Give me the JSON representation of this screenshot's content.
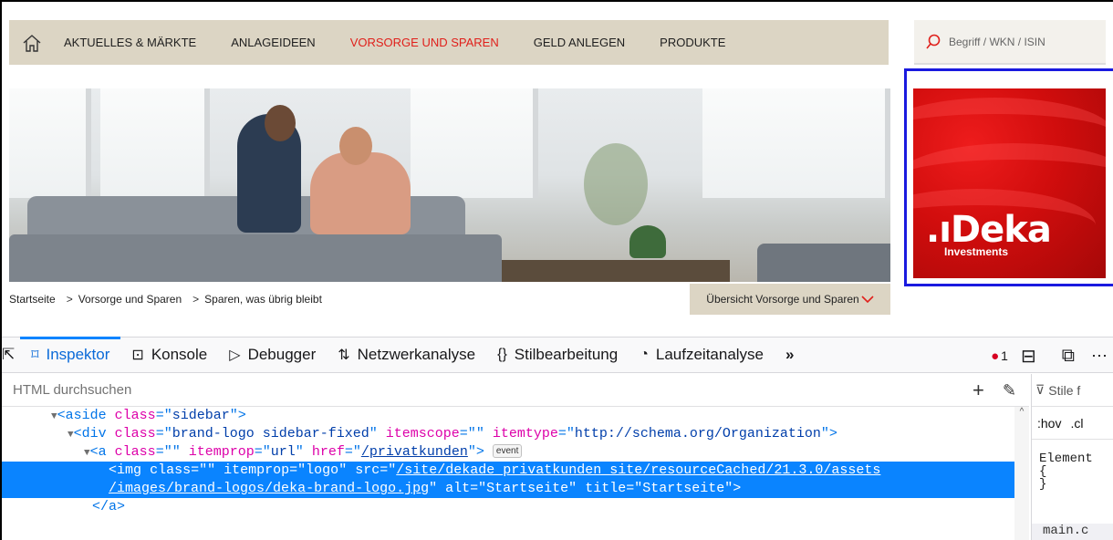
{
  "nav": {
    "items": [
      {
        "label": "AKTUELLES & MÄRKTE",
        "active": false
      },
      {
        "label": "ANLAGEIDEEN",
        "active": false
      },
      {
        "label": "VORSORGE UND SPAREN",
        "active": true
      },
      {
        "label": "GELD ANLEGEN",
        "active": false
      },
      {
        "label": "PRODUKTE",
        "active": false
      }
    ],
    "search_placeholder": "Begriff / WKN / ISIN",
    "accent_color": "#e0201b"
  },
  "logo": {
    "text": ".ıDeka",
    "subtitle": "Investments"
  },
  "breadcrumb": {
    "items": [
      "Startseite",
      "Vorsorge und Sparen",
      "Sparen, was übrig bleibt"
    ],
    "overview_button": "Übersicht Vorsorge und Sparen"
  },
  "devtools": {
    "tabs": [
      {
        "label": "Inspektor",
        "icon": "inspector-icon",
        "active": true
      },
      {
        "label": "Konsole",
        "icon": "console-icon",
        "active": false
      },
      {
        "label": "Debugger",
        "icon": "debugger-icon",
        "active": false
      },
      {
        "label": "Netzwerkanalyse",
        "icon": "network-icon",
        "active": false
      },
      {
        "label": "Stilbearbeitung",
        "icon": "style-editor-icon",
        "active": false
      },
      {
        "label": "Laufzeitanalyse",
        "icon": "performance-icon",
        "active": false
      }
    ],
    "error_count": "1",
    "search_placeholder": "HTML durchsuchen",
    "side_filter": "Stile f",
    "side_hov": ":hov",
    "side_cls": ".cl",
    "side_element": "Element",
    "side_brace_open": "{",
    "side_brace_close": "}",
    "side_file": "main.c",
    "tree": {
      "l1_tag": "aside",
      "l1_attr": "class",
      "l1_val": "sidebar",
      "l2_tag": "div",
      "l2_a1": "class",
      "l2_v1": "brand-logo sidebar-fixed",
      "l2_a2": "itemscope",
      "l2_v2": "",
      "l2_a3": "itemtype",
      "l2_v3": "http://schema.org/Organization",
      "l3_tag": "a",
      "l3_a1": "class",
      "l3_v1": "",
      "l3_a2": "itemprop",
      "l3_v2": "url",
      "l3_a3": "href",
      "l3_v3": "/privatkunden",
      "l3_badge": "event",
      "l4_tag": "img",
      "l4_a1": "class",
      "l4_v1": "",
      "l4_a2": "itemprop",
      "l4_v2": "logo",
      "l4_a3": "src",
      "l4_src1": "/site/dekade_privatkunden_site/resourceCached/21.3.0/assets",
      "l4_src2": "/images/brand-logos/deka-brand-logo.jpg",
      "l4_a4": "alt",
      "l4_v4": "Startseite",
      "l4_a5": "title",
      "l4_v5": "Startseite",
      "l5_close": "</a>"
    }
  }
}
